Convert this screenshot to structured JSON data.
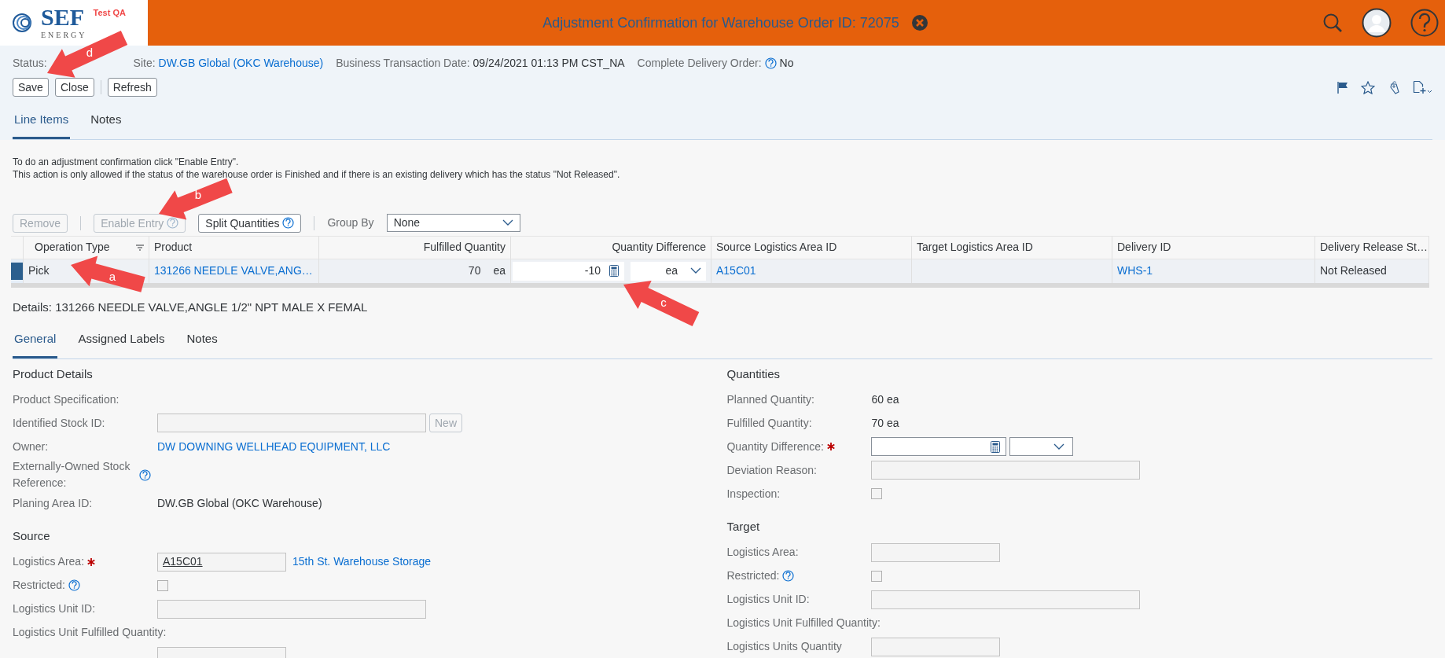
{
  "shell": {
    "logo": {
      "word": "SEF",
      "subword": "ENERGY",
      "tag": "Test QA"
    },
    "title": "Adjustment Confirmation for Warehouse Order ID: 72075"
  },
  "object_header": {
    "fields": [
      {
        "label": "Status:",
        "kind": "covered"
      },
      {
        "label": "Site:",
        "kind": "link",
        "value": "DW.GB Global (OKC Warehouse)"
      },
      {
        "label": "Business Transaction Date:",
        "kind": "text",
        "value": "09/24/2021 01:13 PM CST_NA"
      },
      {
        "label": "Complete Delivery Order:",
        "kind": "text",
        "value": "No",
        "help": true
      }
    ],
    "actions": [
      {
        "label": "Save"
      },
      {
        "label": "Close",
        "separator_after": true
      },
      {
        "label": "Refresh"
      }
    ]
  },
  "tabs": [
    {
      "label": "Line Items",
      "selected": true
    },
    {
      "label": "Notes",
      "selected": false
    }
  ],
  "info_lines": [
    "To do an adjustment confirmation click \"Enable Entry\".",
    "This action is only allowed if the status of the warehouse order is Finished and if there is an existing delivery which has the status \"Not Released\"."
  ],
  "table_toolbar": {
    "buttons": [
      {
        "label": "Remove",
        "disabled": true,
        "separator_after": true
      },
      {
        "label": "Enable Entry",
        "disabled": true,
        "help": true
      },
      {
        "label": "Split Quantities",
        "disabled": false,
        "help": true,
        "separator_after": true
      }
    ],
    "group_by": {
      "label": "Group By",
      "value": "None"
    }
  },
  "table": {
    "columns": [
      {
        "label": "Operation Type",
        "filter": true
      },
      {
        "label": "Product"
      },
      {
        "label": "Fulfilled Quantity"
      },
      {
        "label": "Quantity Difference"
      },
      {
        "label": "Source Logistics Area ID"
      },
      {
        "label": "Target Logistics Area ID"
      },
      {
        "label": "Delivery ID"
      },
      {
        "label": "Delivery Release St…"
      }
    ],
    "rows": [
      {
        "selected": true,
        "cells": [
          {
            "kind": "text",
            "text": "Pick"
          },
          {
            "kind": "link",
            "text": "131266 NEEDLE VALVE,ANG…"
          },
          {
            "kind": "quantity",
            "value": "70",
            "unit": "ea"
          },
          {
            "kind": "quantity_input",
            "value": "-10",
            "unit": "ea"
          },
          {
            "kind": "link",
            "text": "A15C01"
          },
          {
            "kind": "empty"
          },
          {
            "kind": "link",
            "text": "WHS-1"
          },
          {
            "kind": "text",
            "text": "Not Released"
          }
        ]
      }
    ]
  },
  "details": {
    "title": "Details: 131266 NEEDLE VALVE,ANGLE 1/2\" NPT MALE X FEMAL",
    "tabs": [
      {
        "label": "General",
        "selected": true
      },
      {
        "label": "Assigned Labels",
        "selected": false
      },
      {
        "label": "Notes",
        "selected": false
      }
    ],
    "columns": [
      [
        {
          "title": "Product Details",
          "rows": [
            {
              "label": "Product Specification:",
              "kind": "label_only"
            },
            {
              "label": "Identified Stock ID:",
              "kind": "field_with_button",
              "button": "New"
            },
            {
              "label": "Owner:",
              "kind": "link",
              "value": "DW DOWNING WELLHEAD EQUIPMENT, LLC"
            },
            {
              "label": "Externally-Owned Stock Reference:",
              "kind": "none",
              "help": true
            },
            {
              "label": "Planing Area ID:",
              "kind": "text",
              "value": "DW.GB Global (OKC Warehouse)"
            }
          ]
        },
        {
          "title": "Source",
          "rows": [
            {
              "label": "Logistics Area:",
              "kind": "field_with_link",
              "value": "A15C01",
              "link": "15th St. Warehouse Storage",
              "required": true
            },
            {
              "label": "Restricted:",
              "kind": "checkbox",
              "checked": false,
              "help": true
            },
            {
              "label": "Logistics Unit ID:",
              "kind": "long_field"
            },
            {
              "label": "Logistics Unit Fulfilled Quantity:",
              "kind": "label_only"
            },
            {
              "kind": "short_field"
            }
          ]
        }
      ],
      [
        {
          "title": "Quantities",
          "rows": [
            {
              "label": "Planned Quantity:",
              "kind": "text",
              "value": "60 ea"
            },
            {
              "label": "Fulfilled Quantity:",
              "kind": "text",
              "value": "70 ea"
            },
            {
              "label": "Quantity Difference:",
              "kind": "quantity_input",
              "required": true
            },
            {
              "label": "Deviation Reason:",
              "kind": "long_field"
            },
            {
              "label": "Inspection:",
              "kind": "checkbox",
              "checked": false
            }
          ]
        },
        {
          "title": "Target",
          "rows": [
            {
              "label": "Logistics Area:",
              "kind": "short_field"
            },
            {
              "label": "Restricted:",
              "kind": "checkbox",
              "checked": false,
              "help": true
            },
            {
              "label": "Logistics Unit ID:",
              "kind": "long_field"
            },
            {
              "label": "Logistics Unit Fulfilled Quantity:",
              "kind": "label_only"
            },
            {
              "label": "Logistics Units Quantity",
              "kind": "short_field"
            }
          ]
        }
      ]
    ]
  },
  "annotations": [
    {
      "label": "d"
    },
    {
      "label": "b"
    },
    {
      "label": "a"
    },
    {
      "label": "c"
    }
  ]
}
